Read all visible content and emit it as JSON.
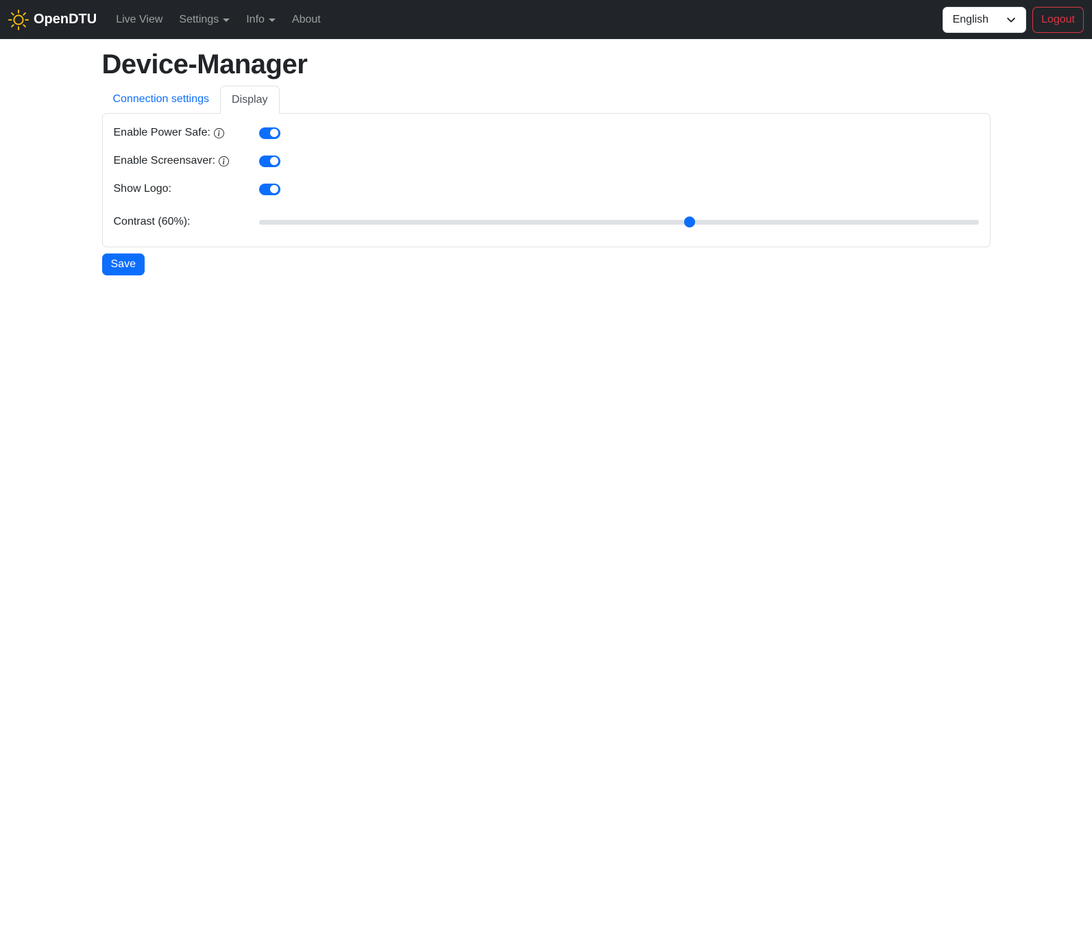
{
  "navbar": {
    "brand": "OpenDTU",
    "items": [
      {
        "label": "Live View",
        "dropdown": false
      },
      {
        "label": "Settings",
        "dropdown": true
      },
      {
        "label": "Info",
        "dropdown": true
      },
      {
        "label": "About",
        "dropdown": false
      }
    ],
    "language": "English",
    "logout_label": "Logout"
  },
  "page": {
    "title": "Device-Manager"
  },
  "tabs": [
    {
      "label": "Connection settings",
      "active": false
    },
    {
      "label": "Display",
      "active": true
    }
  ],
  "form": {
    "rows": [
      {
        "label": "Enable Power Safe:",
        "type": "switch",
        "value": true,
        "has_info": true
      },
      {
        "label": "Enable Screensaver:",
        "type": "switch",
        "value": true,
        "has_info": true
      },
      {
        "label": "Show Logo:",
        "type": "switch",
        "value": true,
        "has_info": false
      },
      {
        "label": "Contrast (60%):",
        "type": "range",
        "value": 60,
        "min": 0,
        "max": 100
      }
    ],
    "save_label": "Save"
  },
  "colors": {
    "primary": "#0d6efd",
    "danger": "#dc3545",
    "navbar_bg": "#212529",
    "brand_icon": "#ffc107",
    "border": "#dee2e6"
  }
}
